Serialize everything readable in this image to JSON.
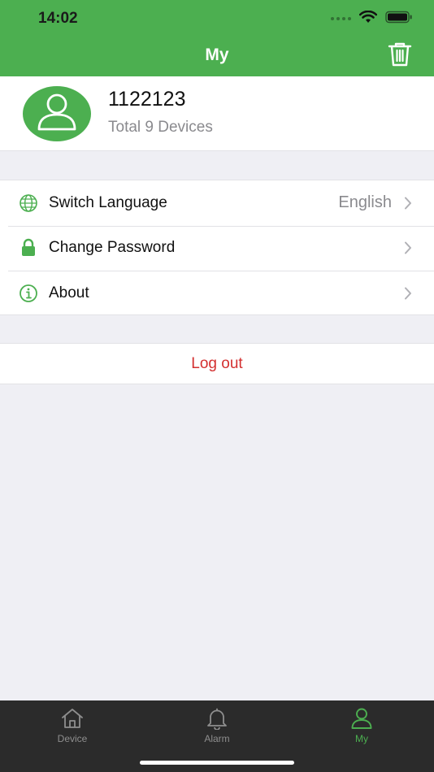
{
  "status_bar": {
    "time": "14:02"
  },
  "nav": {
    "title": "My"
  },
  "profile": {
    "username": "1122123",
    "device_count": "Total 9 Devices"
  },
  "settings": {
    "items": [
      {
        "label": "Switch Language",
        "value": "English",
        "icon": "globe-icon"
      },
      {
        "label": "Change Password",
        "value": "",
        "icon": "lock-icon"
      },
      {
        "label": "About",
        "value": "",
        "icon": "info-icon"
      }
    ]
  },
  "logout": {
    "label": "Log out"
  },
  "tabbar": {
    "tabs": [
      {
        "label": "Device",
        "icon": "home-icon",
        "active": false
      },
      {
        "label": "Alarm",
        "icon": "bell-icon",
        "active": false
      },
      {
        "label": "My",
        "icon": "person-icon",
        "active": true
      }
    ]
  },
  "colors": {
    "brand": "#4caf50",
    "logout": "#d32f2f",
    "tabbar_bg": "#2b2b2b",
    "background": "#efeff4"
  }
}
